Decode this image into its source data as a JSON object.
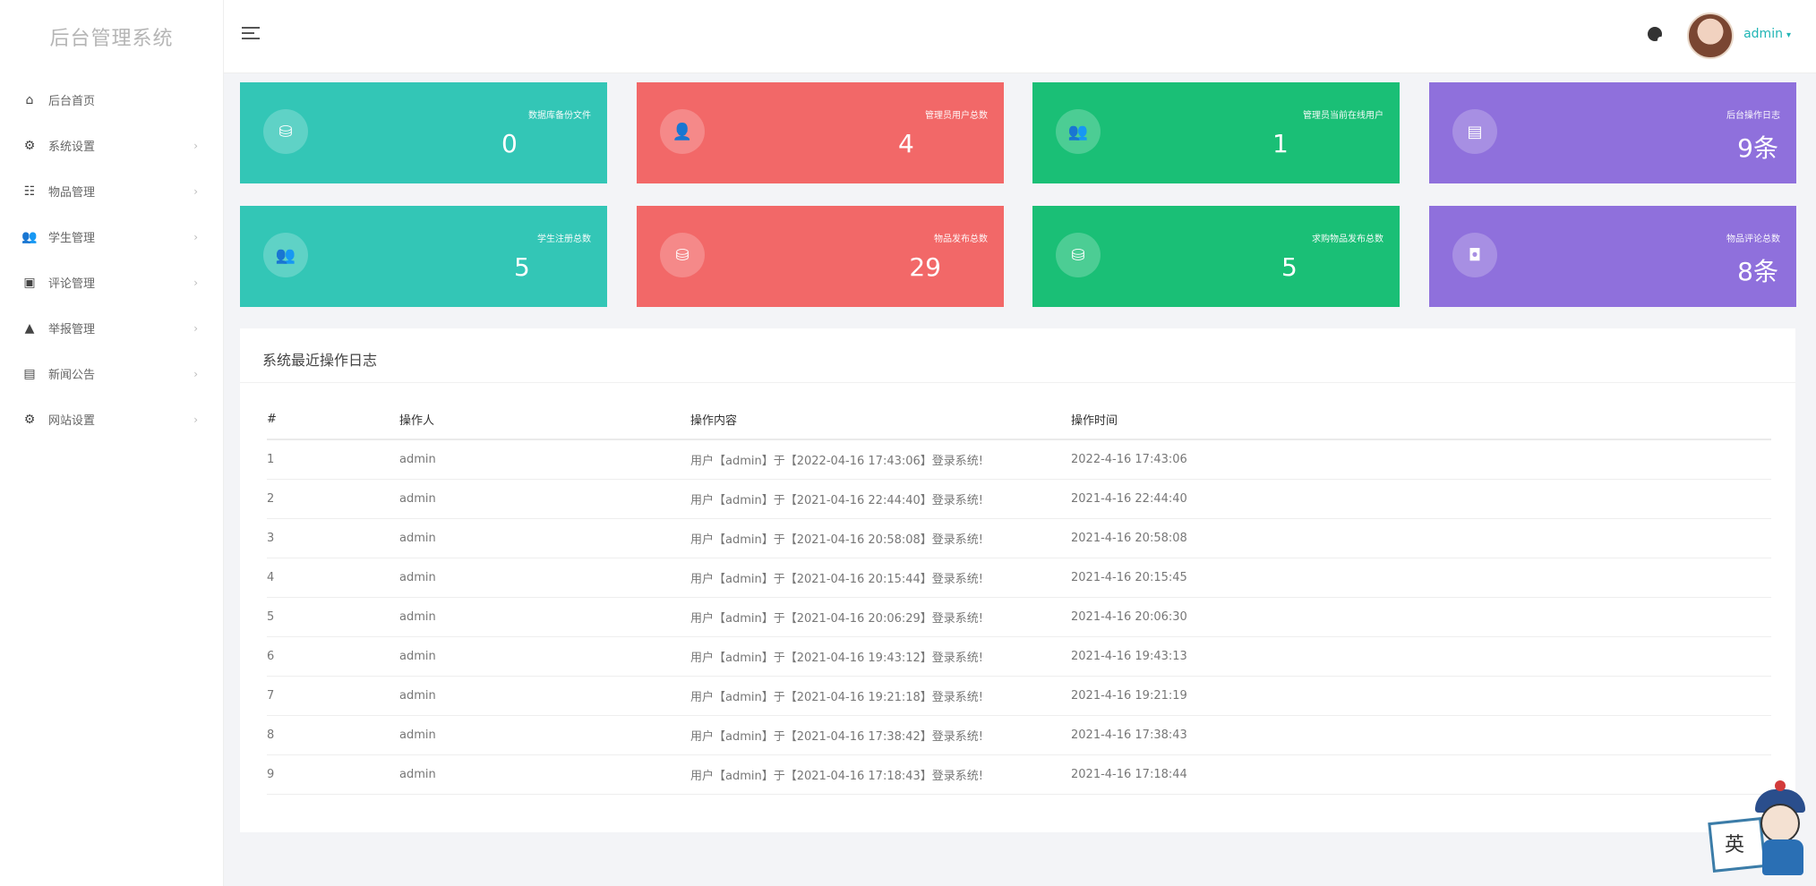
{
  "app": {
    "title": "后台管理系统"
  },
  "sidebar": {
    "items": [
      {
        "label": "后台首页",
        "icon": "home-icon",
        "arrow": ""
      },
      {
        "label": "系统设置",
        "icon": "gear-icon",
        "arrow": "›"
      },
      {
        "label": "物品管理",
        "icon": "box-icon",
        "arrow": "›"
      },
      {
        "label": "学生管理",
        "icon": "users-icon",
        "arrow": "›"
      },
      {
        "label": "评论管理",
        "icon": "comment-icon",
        "arrow": "›"
      },
      {
        "label": "举报管理",
        "icon": "warning-icon",
        "arrow": "›"
      },
      {
        "label": "新闻公告",
        "icon": "news-icon",
        "arrow": "›"
      },
      {
        "label": "网站设置",
        "icon": "settings-icon",
        "arrow": "›"
      }
    ]
  },
  "header": {
    "user": "admin",
    "caret": "▾"
  },
  "stats": [
    {
      "label": "数据库备份文件",
      "value": "0",
      "icon": "database-icon",
      "color": "#33c6b6"
    },
    {
      "label": "管理员用户总数",
      "value": "4",
      "icon": "user-icon",
      "color": "#f26868"
    },
    {
      "label": "管理员当前在线用户",
      "value": "1",
      "icon": "users-icon",
      "color": "#1abf76"
    },
    {
      "label": "后台操作日志",
      "value": "9条",
      "icon": "log-icon",
      "color": "#8f70dc"
    },
    {
      "label": "学生注册总数",
      "value": "5",
      "icon": "users-icon",
      "color": "#33c6b6"
    },
    {
      "label": "物品发布总数",
      "value": "29",
      "icon": "database-icon",
      "color": "#f26868"
    },
    {
      "label": "求购物品发布总数",
      "value": "5",
      "icon": "database-icon",
      "color": "#1abf76"
    },
    {
      "label": "物品评论总数",
      "value": "8条",
      "icon": "comment-icon",
      "color": "#8f70dc"
    }
  ],
  "log": {
    "title": "系统最近操作日志",
    "columns": [
      "#",
      "操作人",
      "操作内容",
      "操作时间"
    ],
    "rows": [
      [
        "1",
        "admin",
        "用户【admin】于【2022-04-16 17:43:06】登录系统!",
        "2022-4-16 17:43:06"
      ],
      [
        "2",
        "admin",
        "用户【admin】于【2021-04-16 22:44:40】登录系统!",
        "2021-4-16 22:44:40"
      ],
      [
        "3",
        "admin",
        "用户【admin】于【2021-04-16 20:58:08】登录系统!",
        "2021-4-16 20:58:08"
      ],
      [
        "4",
        "admin",
        "用户【admin】于【2021-04-16 20:15:44】登录系统!",
        "2021-4-16 20:15:45"
      ],
      [
        "5",
        "admin",
        "用户【admin】于【2021-04-16 20:06:29】登录系统!",
        "2021-4-16 20:06:30"
      ],
      [
        "6",
        "admin",
        "用户【admin】于【2021-04-16 19:43:12】登录系统!",
        "2021-4-16 19:43:13"
      ],
      [
        "7",
        "admin",
        "用户【admin】于【2021-04-16 19:21:18】登录系统!",
        "2021-4-16 19:21:19"
      ],
      [
        "8",
        "admin",
        "用户【admin】于【2021-04-16 17:38:42】登录系统!",
        "2021-4-16 17:38:43"
      ],
      [
        "9",
        "admin",
        "用户【admin】于【2021-04-16 17:18:43】登录系统!",
        "2021-4-16 17:18:44"
      ]
    ]
  },
  "mascot": {
    "char": "英"
  }
}
